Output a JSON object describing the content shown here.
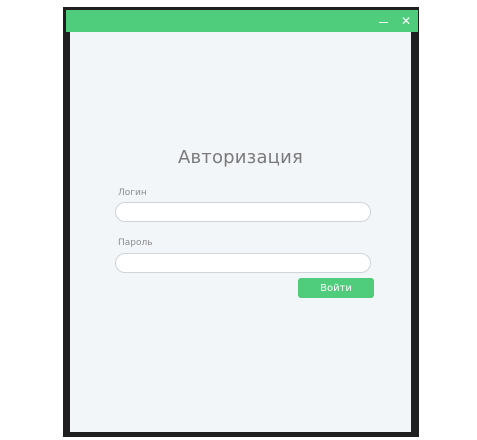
{
  "window": {
    "accent_color": "#4fcc7c",
    "background_color": "#f3f6f9",
    "controls": {
      "minimize_icon": "minimize-icon",
      "close_icon": "close-icon",
      "close_glyph": "✕"
    }
  },
  "auth": {
    "title": "Авторизация",
    "login_label": "Логин",
    "login_value": "",
    "login_placeholder": "",
    "password_label": "Пароль",
    "password_value": "",
    "password_placeholder": "",
    "submit_label": "Войти"
  }
}
